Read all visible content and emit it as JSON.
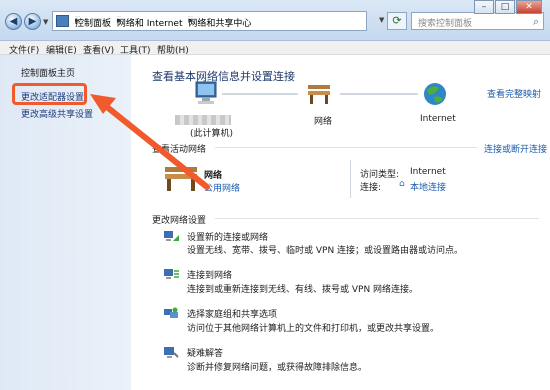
{
  "address_bar": {
    "crumbs": [
      "控制面板",
      "网络和 Internet",
      "网络和共享中心"
    ],
    "search_placeholder": "搜索控制面板"
  },
  "menu": {
    "items": [
      "文件(F)",
      "编辑(E)",
      "查看(V)",
      "工具(T)",
      "帮助(H)"
    ]
  },
  "sidebar": {
    "links": [
      "控制面板主页",
      "更改适配器设置",
      "更改高级共享设置"
    ]
  },
  "main": {
    "title": "查看基本网络信息并设置连接",
    "full_map_link": "查看完整映射",
    "map": {
      "pc_label": "(此计算机)",
      "network_label": "网络",
      "internet_label": "Internet"
    },
    "active_section": {
      "title": "查看活动网络",
      "link": "连接或断开连接",
      "network_name": "网络",
      "network_type": "公用网络",
      "access_type_label": "访问类型:",
      "access_type_value": "Internet",
      "connections_label": "连接:",
      "connections_value": "本地连接"
    },
    "change_section": {
      "title": "更改网络设置",
      "items": [
        {
          "title": "设置新的连接或网络",
          "desc": "设置无线、宽带、拨号、临时或 VPN 连接；或设置路由器或访问点。"
        },
        {
          "title": "连接到网络",
          "desc": "连接到或重新连接到无线、有线、拨号或 VPN 网络连接。"
        },
        {
          "title": "选择家庭组和共享选项",
          "desc": "访问位于其他网络计算机上的文件和打印机，或更改共享设置。"
        },
        {
          "title": "疑难解答",
          "desc": "诊断并修复网络问题，或获得故障排除信息。"
        }
      ]
    }
  },
  "colors": {
    "link": "#1d5cad",
    "heading": "#1e3a6e",
    "highlight": "#f15a2d"
  }
}
